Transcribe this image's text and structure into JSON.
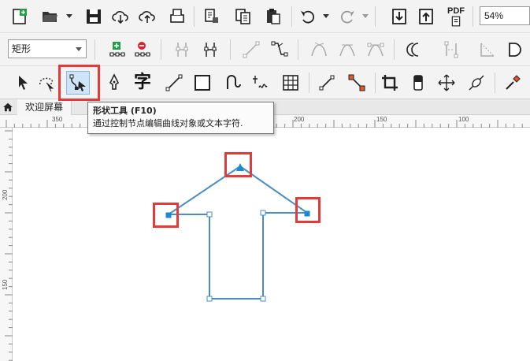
{
  "toolbar_standard": {
    "zoom": "54%",
    "pdf_label": "PDF"
  },
  "property_bar": {
    "object_type": "矩形"
  },
  "document_tabs": {
    "welcome": "欢迎屏幕"
  },
  "rulers": {
    "horizontal_labels": [
      "350",
      "200",
      "150",
      "100"
    ],
    "vertical_labels": [
      "200",
      "150"
    ]
  },
  "tooltip": {
    "title": "形状工具 (F10)",
    "description": "通过控制节点编辑曲线对象或文本字符."
  },
  "colors": {
    "curve": "#4a8cc4",
    "highlight": "#e23b3b",
    "node_fill": "#1a8ad4"
  }
}
